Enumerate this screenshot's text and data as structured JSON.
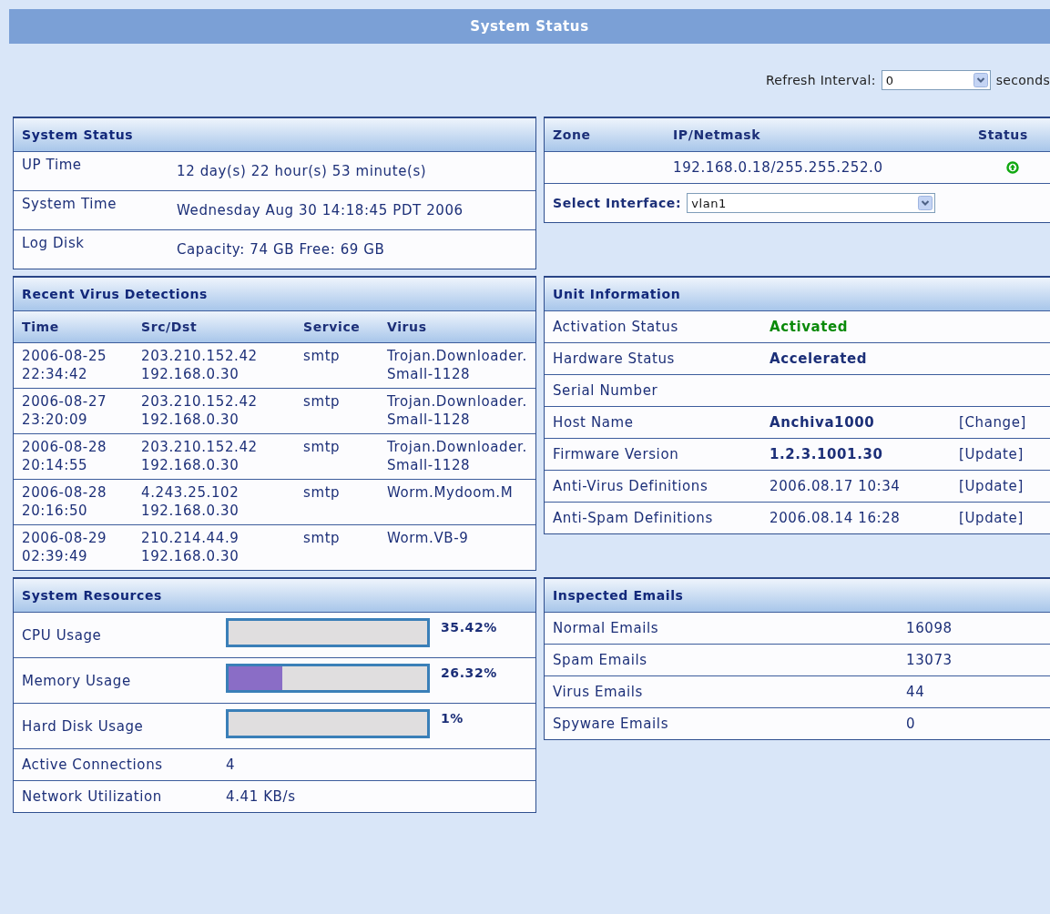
{
  "page_title": "System Status",
  "refresh": {
    "label": "Refresh Interval:",
    "value": "0",
    "unit": "seconds"
  },
  "system_status": {
    "title": "System Status",
    "rows": [
      {
        "label": "UP Time",
        "value": "12 day(s) 22 hour(s) 53 minute(s)"
      },
      {
        "label": "System Time",
        "value": "Wednesday Aug 30 14:18:45 PDT 2006"
      },
      {
        "label": "Log Disk",
        "value": "Capacity: 74 GB Free: 69 GB"
      }
    ]
  },
  "zones": {
    "columns": [
      "Zone",
      "IP/Netmask",
      "Status"
    ],
    "rows": [
      {
        "ip": "192.168.0.18/255.255.252.0",
        "up": true
      }
    ],
    "select_label": "Select Interface:",
    "select_value": "vlan1"
  },
  "virus_detections": {
    "title": "Recent Virus Detections",
    "columns": [
      "Time",
      "Src/Dst",
      "Service",
      "Virus"
    ],
    "rows": [
      {
        "time": "2006-08-25 22:34:42",
        "src_dst": "203.210.152.42 192.168.0.30",
        "service": "smtp",
        "virus": "Trojan.Downloader.Small-1128"
      },
      {
        "time": "2006-08-27 23:20:09",
        "src_dst": "203.210.152.42 192.168.0.30",
        "service": "smtp",
        "virus": "Trojan.Downloader.Small-1128"
      },
      {
        "time": "2006-08-28 20:14:55",
        "src_dst": "203.210.152.42 192.168.0.30",
        "service": "smtp",
        "virus": "Trojan.Downloader.Small-1128"
      },
      {
        "time": "2006-08-28 20:16:50",
        "src_dst": "4.243.25.102 192.168.0.30",
        "service": "smtp",
        "virus": "Worm.Mydoom.M"
      },
      {
        "time": "2006-08-29 02:39:49",
        "src_dst": "210.214.44.9 192.168.0.30",
        "service": "smtp",
        "virus": "Worm.VB-9"
      }
    ]
  },
  "unit_information": {
    "title": "Unit Information",
    "rows": [
      {
        "label": "Activation Status",
        "value": "Activated",
        "kind": "status"
      },
      {
        "label": "Hardware Status",
        "value": "Accelerated",
        "kind": "bold"
      },
      {
        "label": "Serial Number"
      },
      {
        "label": "Host Name",
        "value": "Anchiva1000",
        "kind": "bold",
        "action": "[Change]"
      },
      {
        "label": "Firmware Version",
        "value": "1.2.3.1001.30",
        "kind": "bold",
        "action": "[Update]"
      },
      {
        "label": "Anti-Virus Definitions",
        "value": "2006.08.17 10:34",
        "kind": "plain",
        "action": "[Update]"
      },
      {
        "label": "Anti-Spam Definitions",
        "value": "2006.08.14 16:28",
        "kind": "plain",
        "action": "[Update]"
      }
    ]
  },
  "system_resources": {
    "title": "System Resources",
    "rows": [
      {
        "kind": "meter",
        "label": "CPU Usage",
        "reading": "35.42%"
      },
      {
        "kind": "meter",
        "label": "Memory Usage",
        "level": 0.27,
        "reading": "26.32%"
      },
      {
        "kind": "meter",
        "label": "Hard Disk Usage",
        "reading": "1%"
      },
      {
        "kind": "text",
        "label": "Active Connections",
        "value": "4"
      },
      {
        "kind": "text",
        "label": "Network Utilization",
        "value": "4.41 KB/s"
      }
    ]
  },
  "inspected_emails": {
    "title": "Inspected Emails",
    "rows": [
      {
        "label": "Normal Emails",
        "value": "16098"
      },
      {
        "label": "Spam Emails",
        "value": "13073"
      },
      {
        "label": "Virus Emails",
        "value": "44"
      },
      {
        "label": "Spyware Emails",
        "value": "0"
      }
    ]
  }
}
